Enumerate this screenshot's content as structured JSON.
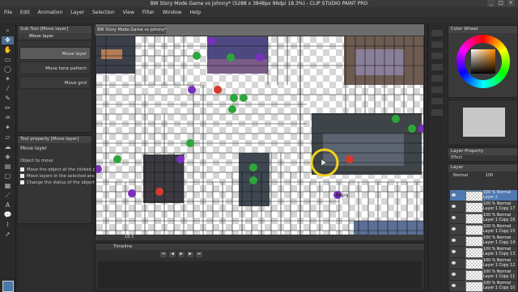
{
  "window": {
    "title": "BW Story Mode Game vs johnny* (5288 x 3848px 96dpi 18.3%) - CLIP STUDIO PAINT PRO",
    "minimize": "_",
    "maximize": "□",
    "close": "×"
  },
  "menubar": [
    "File",
    "Edit",
    "Animation",
    "Layer",
    "Selection",
    "View",
    "Filter",
    "Window",
    "Help"
  ],
  "subtool": {
    "header": "Sub Tool [Move layer]",
    "tab": "Move layer",
    "items": [
      "Move layer",
      "Move tone pattern",
      "Move grid"
    ]
  },
  "tool_property": {
    "header": "Tool property [Move layer]",
    "title": "Move layer",
    "object_to_move": "Object to move",
    "options": [
      "Move the object at the clicked position",
      "Move layers in the selected area",
      "Change the status of the object to move"
    ]
  },
  "canvas": {
    "tab": "BW Story Mode Game vs johnny*",
    "status": "18.3",
    "cursor_icon": "hand-grab-icon",
    "labels": [
      "Bnpg"
    ]
  },
  "timeline": {
    "header": "Timeline"
  },
  "colorwheel": {
    "header": "Color Wheel"
  },
  "layer_property": {
    "header": "Layer Property",
    "effect": "Effect"
  },
  "layers": {
    "header": "Layer",
    "blend": "Normal",
    "opacity": "100",
    "rows": [
      {
        "a": "100 % Normal",
        "b": "Layer 2",
        "selected": true
      },
      {
        "a": "100 % Normal",
        "b": "Layer 1 Copy 17",
        "selected": false
      },
      {
        "a": "100 % Normal",
        "b": "Layer 1 Copy 16",
        "selected": false
      },
      {
        "a": "100 % Normal",
        "b": "Layer 1 Copy 15",
        "selected": false
      },
      {
        "a": "100 % Normal",
        "b": "Layer 1 Copy 14",
        "selected": false
      },
      {
        "a": "100 % Normal",
        "b": "Layer 1 Copy 13",
        "selected": false
      },
      {
        "a": "100 % Normal",
        "b": "Layer 1 Copy 12",
        "selected": false
      },
      {
        "a": "100 % Normal",
        "b": "Layer 1 Copy 11",
        "selected": false
      },
      {
        "a": "100 % Normal",
        "b": "Layer 1 Copy 10",
        "selected": false
      }
    ]
  },
  "colors": {
    "accent": "#4e78b0",
    "panel": "#353535",
    "selected_tool": "#4d6d8c"
  }
}
